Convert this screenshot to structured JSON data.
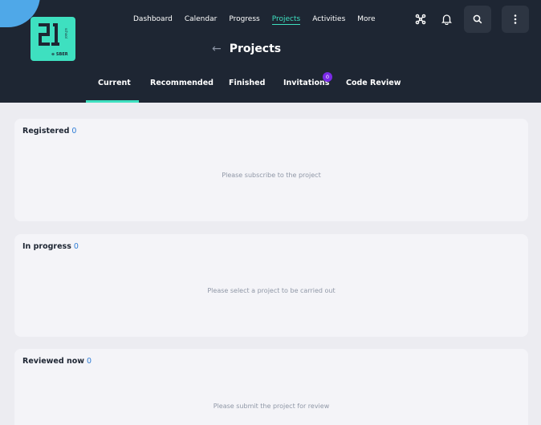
{
  "logo": {
    "brand": "⊜ SBER",
    "vertical": "school"
  },
  "nav": {
    "items": [
      "Dashboard",
      "Calendar",
      "Progress",
      "Projects",
      "Activities",
      "More"
    ],
    "active": "Projects"
  },
  "header_icons": [
    "network-icon",
    "bell-icon",
    "search-icon",
    "kebab-menu-icon"
  ],
  "page": {
    "back": "←",
    "title": "Projects"
  },
  "tabs": {
    "items": [
      "Current",
      "Recommended",
      "Finished",
      "Invitations",
      "Code Review"
    ],
    "active": "Current",
    "invitations_badge": "0"
  },
  "sections": [
    {
      "title": "Registered",
      "count": "0",
      "message": "Please subscribe to the project"
    },
    {
      "title": "In progress",
      "count": "0",
      "message": "Please select a project to be carried out"
    },
    {
      "title": "Reviewed now",
      "count": "0",
      "message": "Please submit the project for review"
    }
  ],
  "colors": {
    "header_bg": "#1e2633",
    "accent": "#3ee0c0",
    "badge": "#7a2ae6",
    "count": "#2f7dd6",
    "page_bg": "#ececf1"
  }
}
